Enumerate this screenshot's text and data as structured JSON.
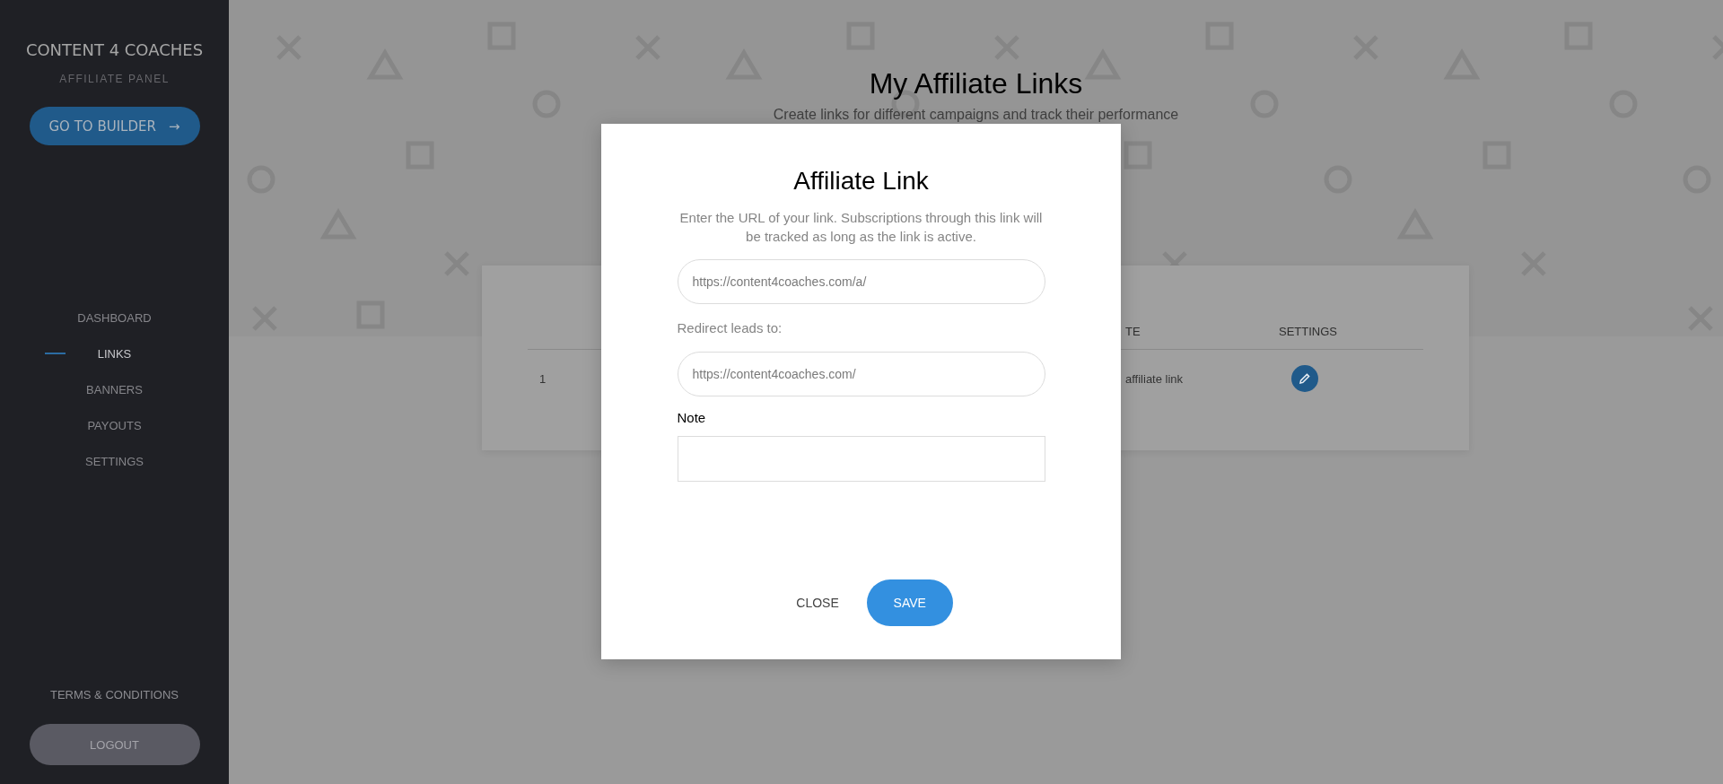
{
  "sidebar": {
    "brand": "CONTENT 4 COACHES",
    "subtitle": "AFFILIATE PANEL",
    "builder_button": {
      "label": "GO TO BUILDER",
      "arrow": "→"
    },
    "nav": [
      {
        "label": "DASHBOARD",
        "selected": false
      },
      {
        "label": "LINKS",
        "selected": true
      },
      {
        "label": "BANNERS",
        "selected": false
      },
      {
        "label": "PAYOUTS",
        "selected": false
      },
      {
        "label": "SETTINGS",
        "selected": false
      }
    ],
    "terms": "TERMS & CONDITIONS",
    "logout": "LOGOUT"
  },
  "page": {
    "title": "My Affiliate Links",
    "subtitle": "Create links for different campaigns and track their performance"
  },
  "table": {
    "column_3": "TE",
    "column_4": "SETTINGS",
    "rows": [
      {
        "column_1": "1",
        "column_3": "affiliate link"
      }
    ]
  },
  "modal": {
    "title": "Affiliate Link",
    "description": "Enter the URL of your link. Subscriptions through this link will be tracked as long as the link is active.",
    "url_field": {
      "value": "https://content4coaches.com/a/"
    },
    "redirect_label": "Redirect leads to:",
    "redirect_field": {
      "value": "https://content4coaches.com/"
    },
    "note_label": "Note",
    "buttons": [
      {
        "label": "CLOSE",
        "kind": "text"
      },
      {
        "label": "SAVE",
        "kind": "primary"
      }
    ]
  }
}
